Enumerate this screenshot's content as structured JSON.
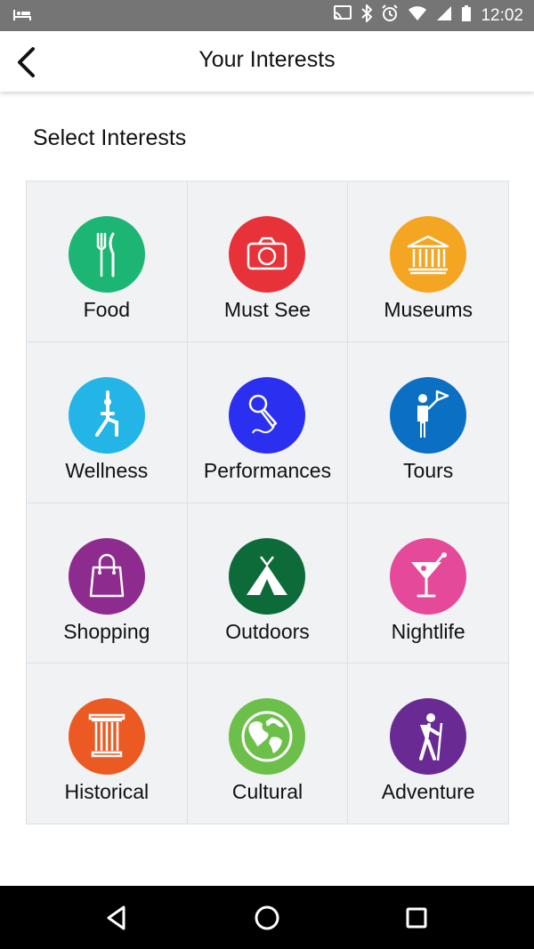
{
  "status_bar": {
    "time": "12:02"
  },
  "header": {
    "title": "Your Interests"
  },
  "section": {
    "heading": "Select Interests"
  },
  "interests": [
    {
      "label": "Food",
      "color": "#1db574",
      "icon": "cutlery-icon"
    },
    {
      "label": "Must See",
      "color": "#e8323a",
      "icon": "camera-icon"
    },
    {
      "label": "Museums",
      "color": "#f4a522",
      "icon": "museum-icon"
    },
    {
      "label": "Wellness",
      "color": "#23b5e5",
      "icon": "yoga-icon"
    },
    {
      "label": "Performances",
      "color": "#2b2ff0",
      "icon": "microphone-icon"
    },
    {
      "label": "Tours",
      "color": "#0b6fc4",
      "icon": "tour-guide-icon"
    },
    {
      "label": "Shopping",
      "color": "#8e2b8f",
      "icon": "shopping-bag-icon"
    },
    {
      "label": "Outdoors",
      "color": "#0d6b3a",
      "icon": "tent-icon"
    },
    {
      "label": "Nightlife",
      "color": "#e54a9a",
      "icon": "cocktail-icon"
    },
    {
      "label": "Historical",
      "color": "#ec5a24",
      "icon": "column-icon"
    },
    {
      "label": "Cultural",
      "color": "#6cc04a",
      "icon": "globe-icon"
    },
    {
      "label": "Adventure",
      "color": "#6a2a93",
      "icon": "hiker-icon"
    }
  ]
}
